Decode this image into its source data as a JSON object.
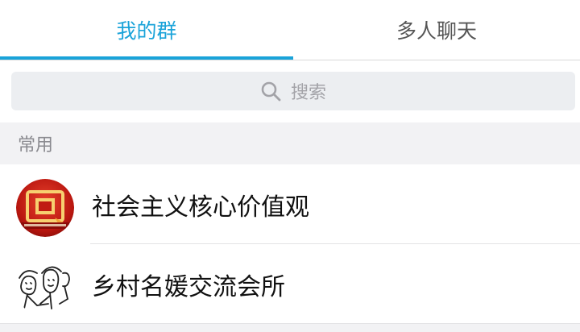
{
  "colors": {
    "accent": "#1aa3d9",
    "tab_inactive": "#555555"
  },
  "tabs": [
    {
      "label": "我的群",
      "active": true
    },
    {
      "label": "多人聊天",
      "active": false
    }
  ],
  "search": {
    "icon": "search-icon",
    "placeholder": "搜索"
  },
  "section": {
    "title": "常用"
  },
  "groups": [
    {
      "name": "社会主义核心价值观",
      "avatar": "red-flag-avatar"
    },
    {
      "name": "乡村名媛交流会所",
      "avatar": "sketch-figures-avatar"
    }
  ]
}
